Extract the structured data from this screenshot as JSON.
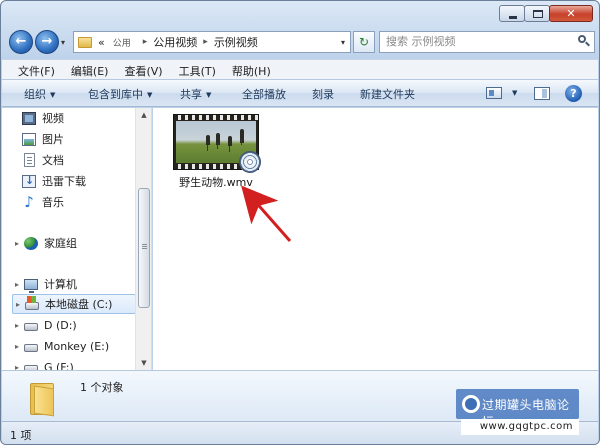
{
  "window": {
    "caption": {
      "minimize": "",
      "maximize": "",
      "close": "✕"
    }
  },
  "nav": {
    "back_icon": "back-arrow-icon",
    "forward_icon": "forward-arrow-icon",
    "history_dropdown": "▾"
  },
  "address": {
    "prefix": "«",
    "crumbs": [
      "公用",
      "公用视频",
      "示例视频"
    ],
    "separator": "▸",
    "dropdown": "▾",
    "refresh": "↻"
  },
  "search": {
    "placeholder": "搜索 示例视频"
  },
  "menubar": {
    "items": [
      "文件(F)",
      "编辑(E)",
      "查看(V)",
      "工具(T)",
      "帮助(H)"
    ]
  },
  "toolbar": {
    "organize": "组织",
    "include_in_library": "包含到库中",
    "share": "共享",
    "play_all": "全部播放",
    "burn": "刻录",
    "new_folder": "新建文件夹",
    "dropdown": "▼",
    "help": "?"
  },
  "navpane": {
    "items": [
      {
        "label": "视频",
        "icon": "video-icon"
      },
      {
        "label": "图片",
        "icon": "pictures-icon"
      },
      {
        "label": "文档",
        "icon": "documents-icon"
      },
      {
        "label": "迅雷下载",
        "icon": "download-icon"
      },
      {
        "label": "音乐",
        "icon": "music-icon"
      },
      {
        "label": "家庭组",
        "icon": "homegroup-icon"
      },
      {
        "label": "计算机",
        "icon": "computer-icon"
      },
      {
        "label": "本地磁盘 (C:)",
        "icon": "drive-icon"
      },
      {
        "label": "D (D:)",
        "icon": "drive-icon"
      },
      {
        "label": "Monkey (E:)",
        "icon": "drive-icon"
      },
      {
        "label": "G (F:)",
        "icon": "drive-icon"
      }
    ],
    "expand_glyph": "▸",
    "selected_index": 7
  },
  "scrollbar": {
    "up": "▲",
    "down": "▼"
  },
  "files": [
    {
      "name": "野生动物.wmv",
      "icon": "video-thumbnail"
    }
  ],
  "details": {
    "count": "1 个对象"
  },
  "statusbar": {
    "items": "1 项"
  },
  "watermark": {
    "text": "过期罐头电脑论坛",
    "url": "www.gqgtpc.com"
  },
  "colors": {
    "annotation_arrow": "#d21f1f",
    "accent": "#2e6fc0"
  }
}
